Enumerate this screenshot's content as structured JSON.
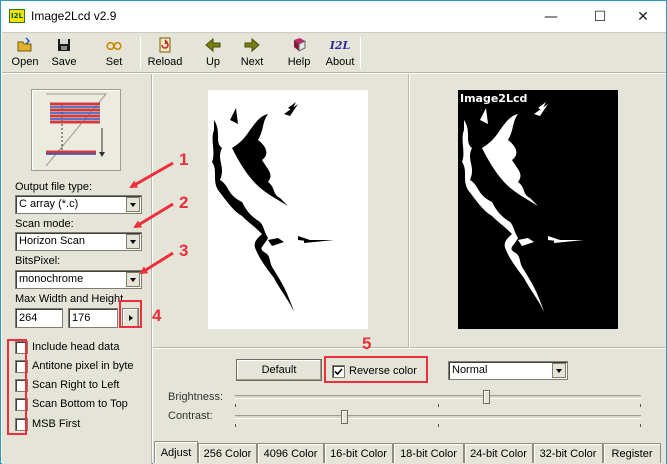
{
  "window": {
    "title": "Image2Lcd v2.9",
    "icon_text": "I2L",
    "controls": {
      "minimize": "—",
      "maximize": "☐",
      "close": "✕"
    }
  },
  "toolbar": {
    "items": [
      {
        "label": "Open",
        "icon": "open-folder-icon"
      },
      {
        "label": "Save",
        "icon": "floppy-disk-icon"
      },
      {
        "label": "Set",
        "icon": "glasses-icon"
      },
      {
        "label": "Reload",
        "icon": "reload-icon"
      },
      {
        "label": "Up",
        "icon": "arrow-left-icon"
      },
      {
        "label": "Next",
        "icon": "arrow-right-icon"
      },
      {
        "label": "Help",
        "icon": "help-book-icon"
      },
      {
        "label": "About",
        "icon": "i2l-logo-icon",
        "icon_text": "I2L"
      }
    ]
  },
  "settings": {
    "output_file_type": {
      "label": "Output file type:",
      "value": "C array (*.c)"
    },
    "scan_mode": {
      "label": "Scan mode:",
      "value": "Horizon Scan"
    },
    "bits_pixel": {
      "label": "BitsPixel:",
      "value": "monochrome"
    },
    "max_size": {
      "label": "Max Width and Height",
      "width": "264",
      "height": "176"
    },
    "options": [
      {
        "label": "Include head data",
        "checked": false
      },
      {
        "label": "Antitone pixel in byte",
        "checked": false
      },
      {
        "label": "Scan Right to Left",
        "checked": false
      },
      {
        "label": "Scan Bottom to Top",
        "checked": false
      },
      {
        "label": "MSB First",
        "checked": false
      }
    ]
  },
  "preview": {
    "output_caption": "Image2Lcd"
  },
  "adjust": {
    "default_label": "Default",
    "reverse_color": {
      "label": "Reverse color",
      "checked": true
    },
    "mode": "Normal",
    "brightness_label": "Brightness:",
    "contrast_label": "Contrast:",
    "brightness_level": 0.62,
    "contrast_level": 0.27
  },
  "tabs": [
    {
      "label": "Adjust",
      "active": true
    },
    {
      "label": "256 Color"
    },
    {
      "label": "4096 Color"
    },
    {
      "label": "16-bit Color"
    },
    {
      "label": "18-bit Color"
    },
    {
      "label": "24-bit Color"
    },
    {
      "label": "32-bit Color"
    },
    {
      "label": "Register"
    }
  ],
  "annotations": {
    "marks": [
      "1",
      "2",
      "3",
      "4",
      "5"
    ],
    "color": "#ec2f3a"
  }
}
